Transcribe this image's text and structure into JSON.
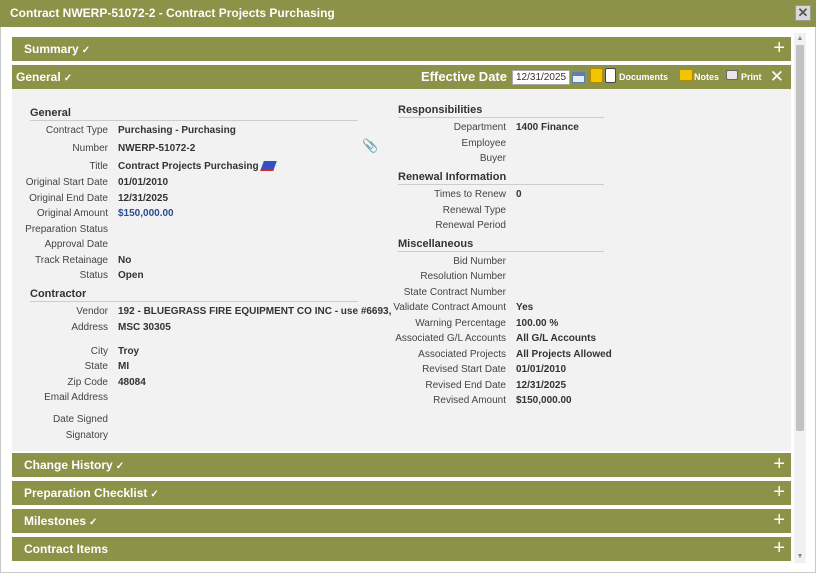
{
  "window": {
    "title": "Contract NWERP-51072-2 - Contract Projects Purchasing",
    "close_glyph": "✕"
  },
  "sections": {
    "summary": "Summary",
    "general": "General",
    "change_history": "Change History",
    "preparation_checklist": "Preparation Checklist",
    "milestones": "Milestones",
    "contract_items": "Contract Items",
    "check_glyph": "✓",
    "expand_glyph": "+"
  },
  "toolbar": {
    "effective_date_label": "Effective Date",
    "effective_date_value": "12/31/2025",
    "documents_label": "Documents",
    "notes_label": "Notes",
    "print_label": "Print",
    "close_glyph": "✕"
  },
  "general": {
    "heading": "General",
    "fields": [
      {
        "label": "Contract Type",
        "value": "Purchasing - Purchasing"
      },
      {
        "label": "Number",
        "value": "NWERP-51072-2"
      },
      {
        "label": "Title",
        "value": "Contract Projects Purchasing"
      },
      {
        "label": "Original Start Date",
        "value": "01/01/2010"
      },
      {
        "label": "Original End Date",
        "value": "12/31/2025"
      },
      {
        "label": "Original Amount",
        "value": "$150,000.00"
      },
      {
        "label": "Preparation Status",
        "value": ""
      },
      {
        "label": "Approval Date",
        "value": ""
      },
      {
        "label": "Track Retainage",
        "value": "No"
      },
      {
        "label": "Status",
        "value": "Open"
      }
    ]
  },
  "contractor": {
    "heading": "Contractor",
    "vendor_label": "Vendor",
    "vendor_value": "192 - BLUEGRASS FIRE EQUIPMENT CO INC - use #6693,",
    "address_label": "Address",
    "address_value": "MSC 30305",
    "city_label": "City",
    "city_value": "Troy",
    "state_label": "State",
    "state_value": "MI",
    "zip_label": "Zip Code",
    "zip_value": "48084",
    "email_label": "Email Address",
    "date_signed_label": "Date Signed",
    "signatory_label": "Signatory"
  },
  "responsibilities": {
    "heading": "Responsibilities",
    "department_label": "Department",
    "department_value": "1400 Finance",
    "employee_label": "Employee",
    "buyer_label": "Buyer"
  },
  "renewal": {
    "heading": "Renewal Information",
    "times_label": "Times to Renew",
    "times_value": "0",
    "type_label": "Renewal Type",
    "period_label": "Renewal Period"
  },
  "misc": {
    "heading": "Miscellaneous",
    "fields": [
      {
        "label": "Bid Number",
        "value": ""
      },
      {
        "label": "Resolution Number",
        "value": ""
      },
      {
        "label": "State Contract Number",
        "value": ""
      },
      {
        "label": "Validate Contract Amount",
        "value": "Yes"
      },
      {
        "label": "Warning Percentage",
        "value": "100.00 %"
      },
      {
        "label": "Associated G/L Accounts",
        "value": "All G/L Accounts"
      },
      {
        "label": "Associated Projects",
        "value": "All Projects Allowed"
      },
      {
        "label": "Revised Start Date",
        "value": "01/01/2010"
      },
      {
        "label": "Revised End Date",
        "value": "12/31/2025"
      },
      {
        "label": "Revised Amount",
        "value": "$150,000.00"
      }
    ]
  },
  "colors": {
    "section_bar": "#8c9247",
    "content_bg": "#f2f2f2",
    "amount_link": "#2a4d8f"
  }
}
